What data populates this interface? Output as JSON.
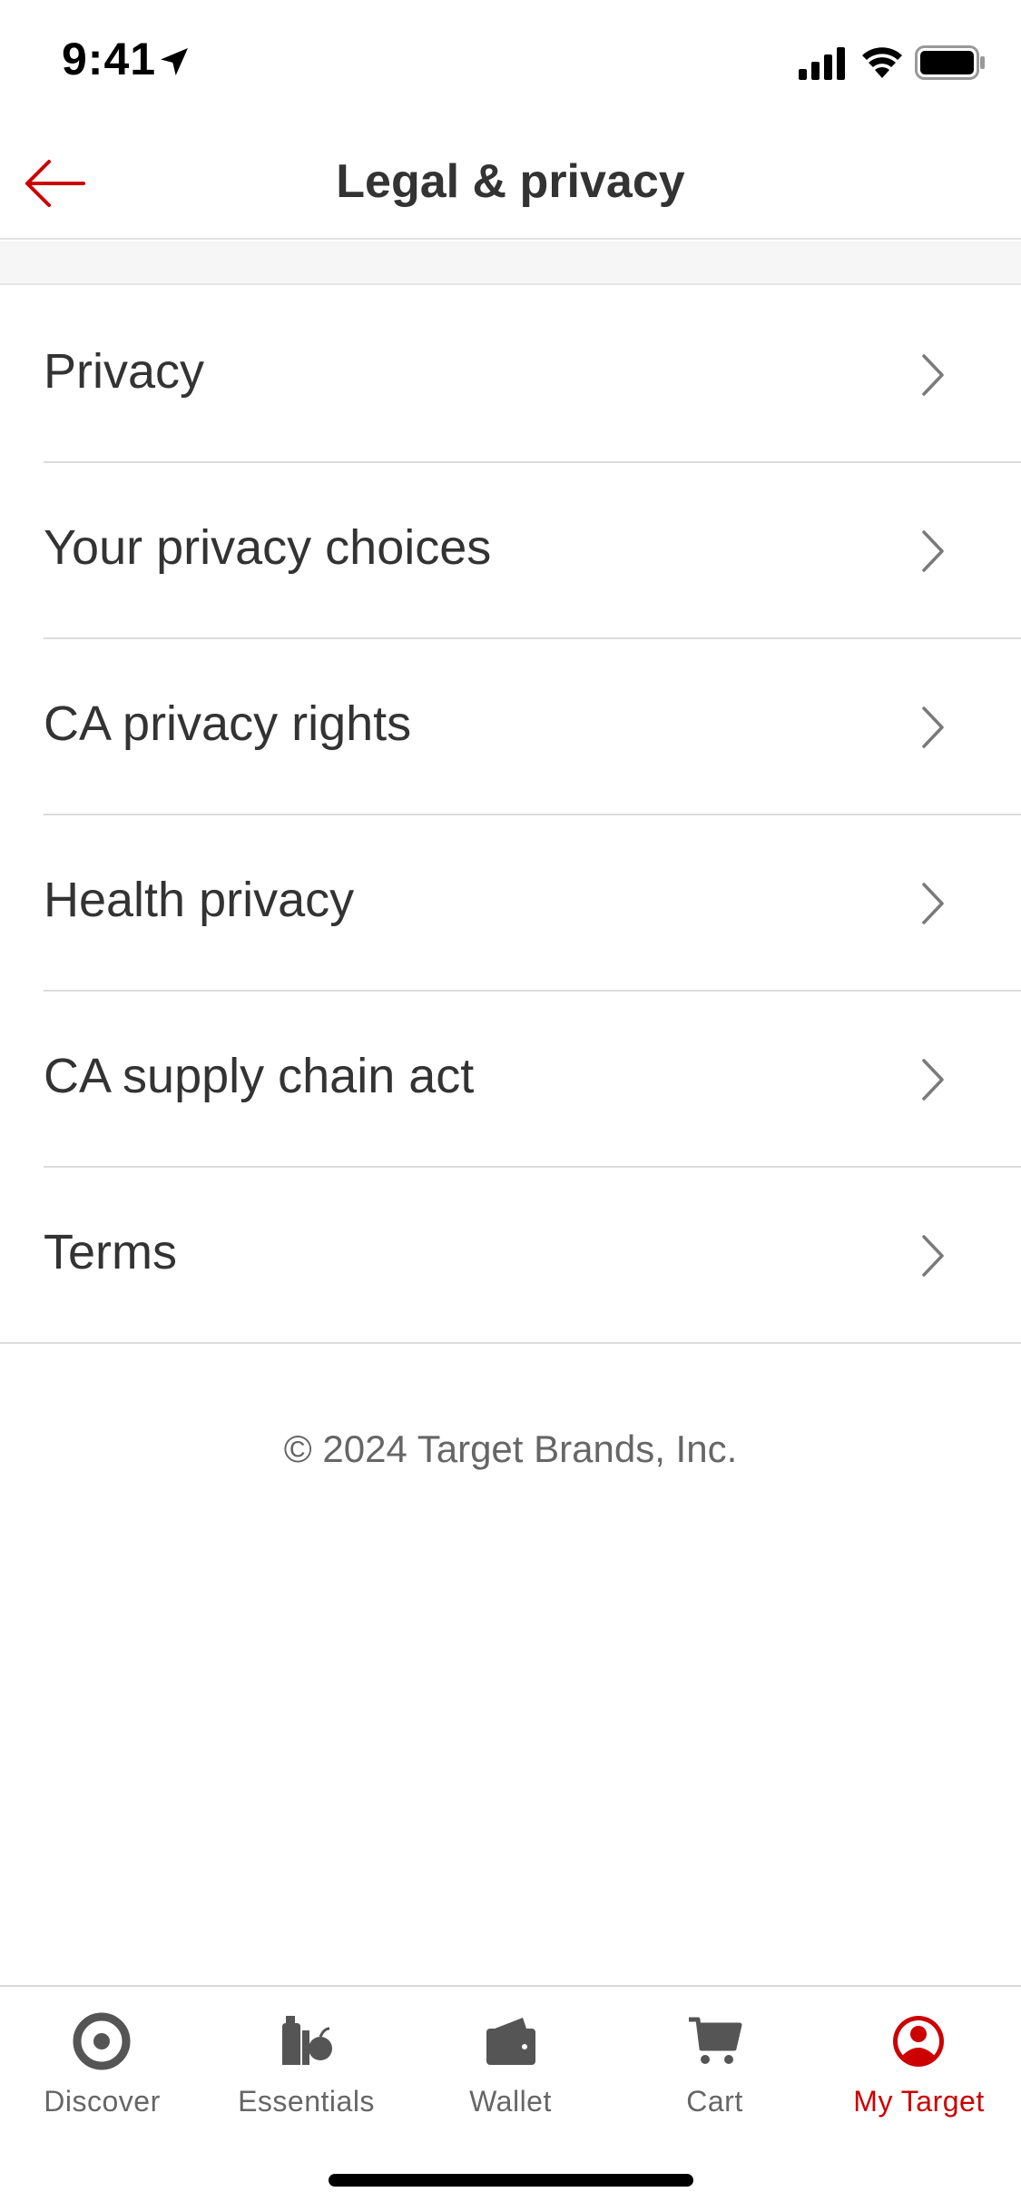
{
  "status": {
    "time": "9:41"
  },
  "header": {
    "title": "Legal & privacy"
  },
  "list": {
    "items": [
      {
        "label": "Privacy"
      },
      {
        "label": "Your privacy choices"
      },
      {
        "label": "CA privacy rights"
      },
      {
        "label": "Health privacy"
      },
      {
        "label": "CA supply chain act"
      },
      {
        "label": "Terms"
      }
    ]
  },
  "footer": {
    "copyright": "© 2024 Target Brands, Inc."
  },
  "tabs": [
    {
      "label": "Discover",
      "icon": "target-bullseye-icon"
    },
    {
      "label": "Essentials",
      "icon": "essentials-icon"
    },
    {
      "label": "Wallet",
      "icon": "wallet-icon"
    },
    {
      "label": "Cart",
      "icon": "cart-icon"
    },
    {
      "label": "My Target",
      "icon": "profile-icon",
      "active": true
    }
  ],
  "colors": {
    "accent": "#cc0000",
    "text": "#333333",
    "muted": "#666666",
    "divider": "#dcdcdc"
  }
}
